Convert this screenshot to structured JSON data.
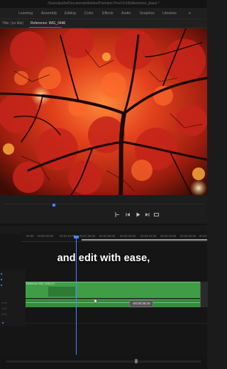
{
  "window": {
    "title": "/Users/justin/Documents/Adobe/Premiere Pro/14.0/Edits/series_piano.*"
  },
  "workspaces": [
    "Learning",
    "Assembly",
    "Editing",
    "Color",
    "Effects",
    "Audio",
    "Graphics",
    "Libraries"
  ],
  "workspace_more": "»",
  "panel_tabs": [
    {
      "label": "Title: (no title)",
      "active": false
    },
    {
      "label": "Reference: IMG_0446",
      "active": true
    },
    {
      "label": "≡",
      "active": false
    }
  ],
  "transport_icons": [
    "mark-in-icon",
    "step-back-icon",
    "play-icon",
    "step-forward-icon",
    "export-frame-icon"
  ],
  "ruler_ticks": [
    "00:00",
    "00:00:32:00",
    "00:01:04:00",
    "00:01:36:00",
    "00:02:08:00",
    "00:02:40:00",
    "00:03:12:00",
    "00:03:44:00",
    "00:04:16:00",
    "00:04"
  ],
  "caption": {
    "text": "and edit with ease,"
  },
  "clip": {
    "label": "Reference IMG_0446 [V]"
  },
  "timecode_tip": "-00:00:36:19",
  "colors": {
    "accent": "#3f8cff",
    "clip_green": "#3f9e45",
    "panel": "#1b1b1b"
  }
}
